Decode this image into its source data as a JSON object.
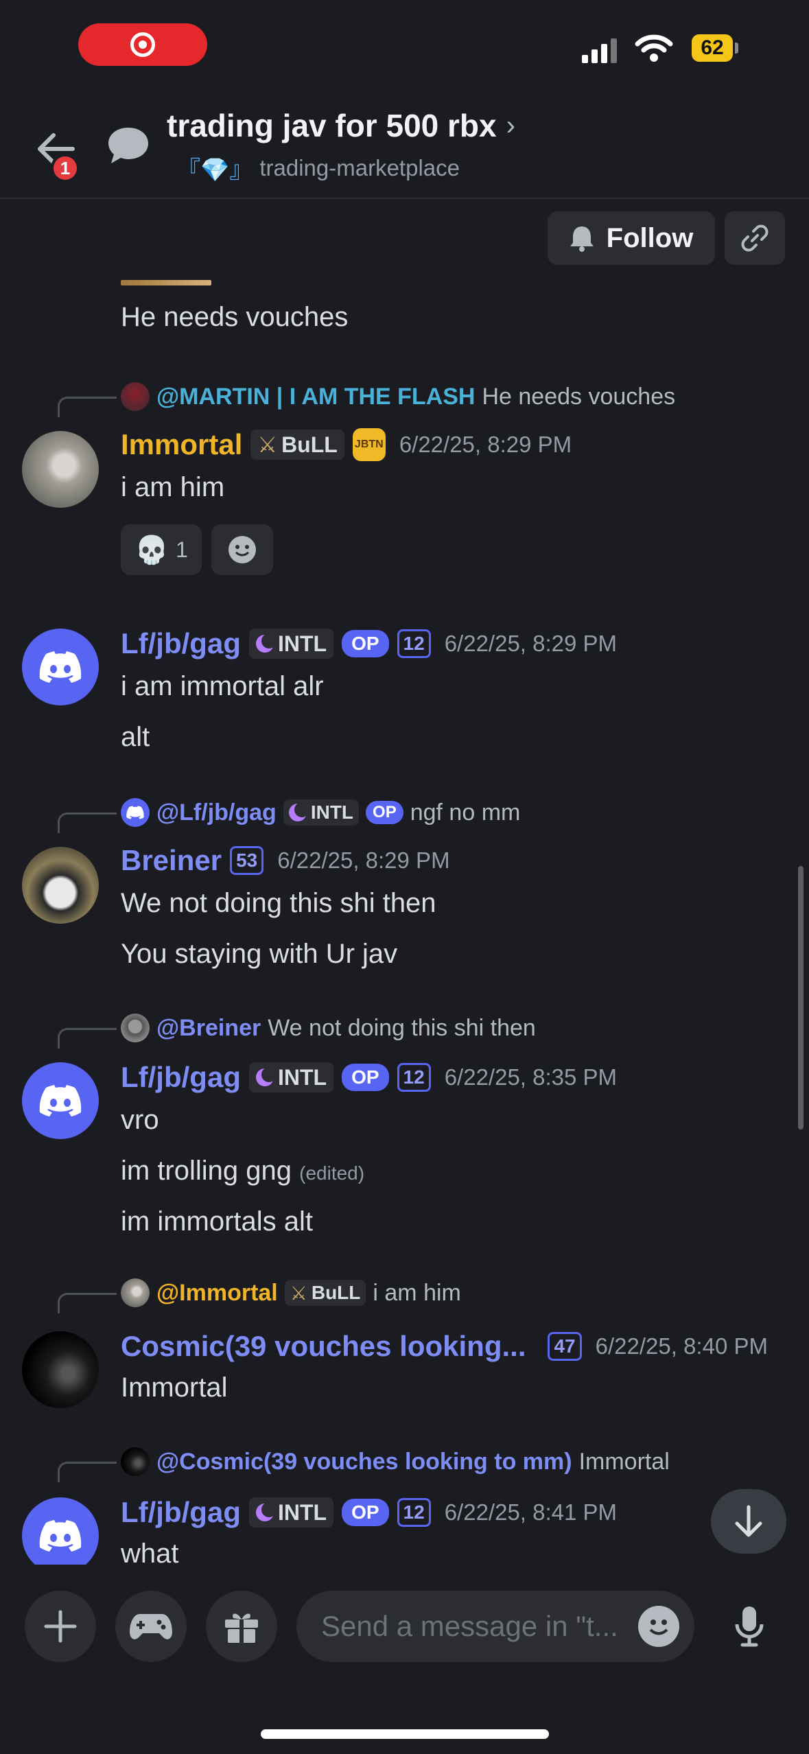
{
  "status_bar": {
    "battery": "62"
  },
  "header": {
    "back_badge": "1",
    "title": "trading jav for 500 rbx",
    "channel_prefix": "『💎』",
    "channel_name": "trading-marketplace"
  },
  "follow_label": "Follow",
  "messages": {
    "m0_text": "He needs vouches",
    "m1": {
      "reply_user": "@MARTIN | I AM THE FLASH",
      "reply_text": "He needs vouches",
      "author": "Immortal",
      "tag": "BuLL",
      "badge": "JBTN",
      "time": "6/22/25, 8:29 PM",
      "line1": "i am him",
      "reaction_count": "1",
      "color": "#f0b428"
    },
    "m2": {
      "author": "Lf/jb/gag",
      "tag": "INTL",
      "op": "OP",
      "level": "12",
      "time": "6/22/25, 8:29 PM",
      "line1": "i am immortal alr",
      "line2": "alt",
      "color": "#7e8df5"
    },
    "m3": {
      "reply_user": "@Lf/jb/gag",
      "reply_tag": "INTL",
      "reply_op": "OP",
      "reply_text": "ngf no mm",
      "author": "Breiner",
      "level": "53",
      "time": "6/22/25, 8:29 PM",
      "line1": "We not doing this shi then",
      "line2": "You staying with Ur jav"
    },
    "m4": {
      "reply_user": "@Breiner",
      "reply_text": "We not doing this shi then",
      "author": "Lf/jb/gag",
      "tag": "INTL",
      "op": "OP",
      "level": "12",
      "time": "6/22/25, 8:35 PM",
      "line1": "vro",
      "line2": "im trolling gng",
      "edited": "(edited)",
      "line3": "im immortals alt"
    },
    "m5": {
      "reply_user": "@Immortal",
      "reply_tag": "BuLL",
      "reply_text": "i am him",
      "author": "Cosmic(39 vouches looking...",
      "level": "47",
      "time": "6/22/25, 8:40 PM",
      "line1": "Immortal"
    },
    "m6": {
      "reply_user": "@Cosmic(39 vouches looking to mm)",
      "reply_text": "Immortal",
      "author": "Lf/jb/gag",
      "tag": "INTL",
      "op": "OP",
      "level": "12",
      "time": "6/22/25, 8:41 PM",
      "line1": "what"
    }
  },
  "composer": {
    "placeholder": "Send a message in \"t..."
  }
}
